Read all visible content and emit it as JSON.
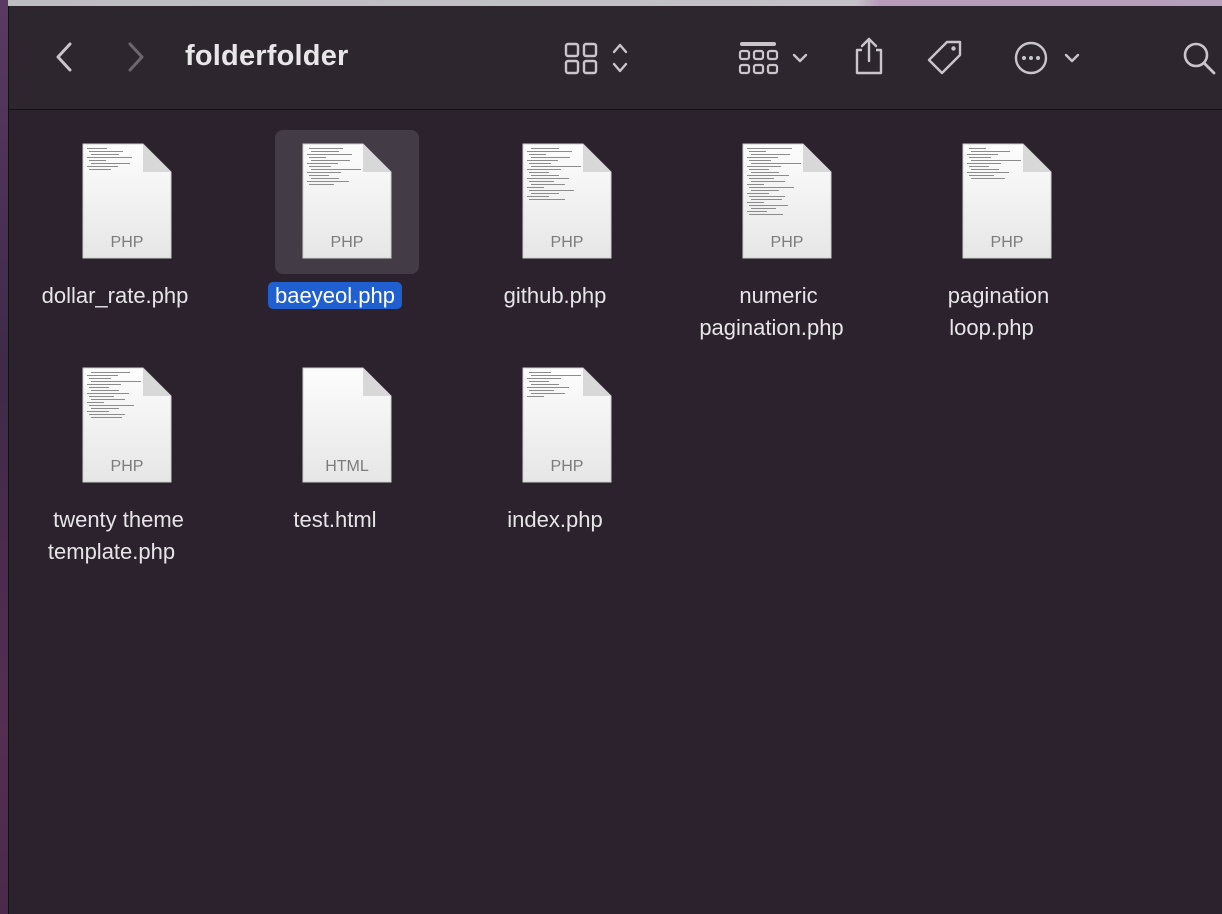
{
  "window": {
    "title": "folderfolder"
  },
  "toolbar": {
    "back_icon": "chevron-left-icon",
    "forward_icon": "chevron-right-icon",
    "view_icon": "grid-view-icon",
    "group_icon": "group-grid-icon",
    "share_icon": "share-icon",
    "tag_icon": "tag-icon",
    "more_icon": "ellipsis-circle-icon",
    "search_icon": "search-icon"
  },
  "files": [
    {
      "name": "dollar_rate.php",
      "ext": "PHP",
      "selected": false
    },
    {
      "name": "baeyeol.php",
      "ext": "PHP",
      "selected": true
    },
    {
      "name": "github.php",
      "ext": "PHP",
      "selected": false
    },
    {
      "name": "numeric pagination.php",
      "ext": "PHP",
      "selected": false
    },
    {
      "name": "pagination loop.php",
      "ext": "PHP",
      "selected": false
    },
    {
      "name": "twenty theme template.php",
      "ext": "PHP",
      "selected": false
    },
    {
      "name": "test.html",
      "ext": "HTML",
      "selected": false
    },
    {
      "name": "index.php",
      "ext": "PHP",
      "selected": false
    }
  ],
  "colors": {
    "window_bg": "#2b222d",
    "selection": "#1f5fcf",
    "selected_icon_bg": "#433b45"
  }
}
